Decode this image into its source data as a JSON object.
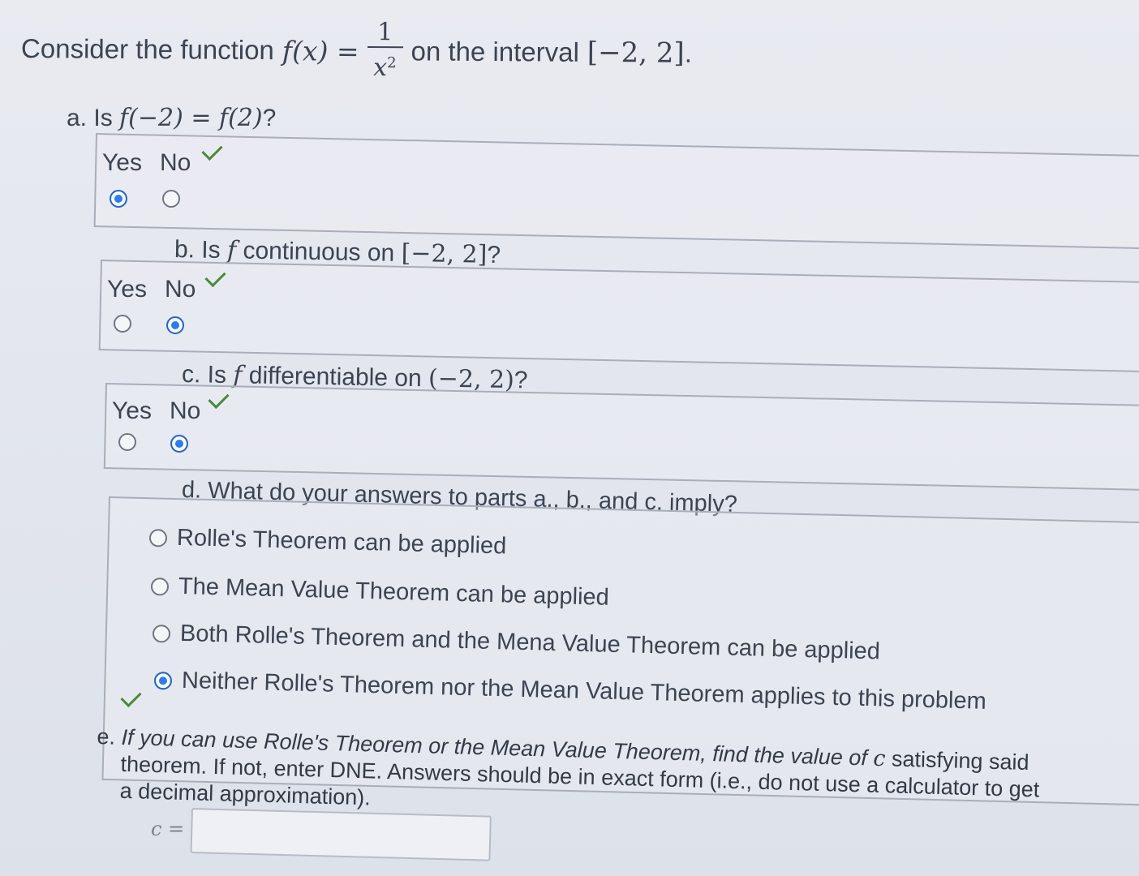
{
  "intro": {
    "prefix": "Consider the function",
    "func": "f(x) =",
    "numerator": "1",
    "denominator": "x",
    "exponent": "2",
    "middle": "on the interval",
    "interval": "[−2, 2]",
    "end": "."
  },
  "part_a": {
    "prefix": "a. Is",
    "expr": "f(−2) = f(2)",
    "suffix": "?",
    "yes_label": "Yes",
    "no_label": "No",
    "selected": "Yes"
  },
  "part_b": {
    "prefix": "b. Is",
    "f": "f",
    "middle": "continuous on",
    "interval": "[−2, 2]",
    "suffix": "?",
    "yes_label": "Yes",
    "no_label": "No",
    "selected": "No"
  },
  "part_c": {
    "prefix": "c. Is",
    "f": "f",
    "middle": "differentiable on",
    "interval": "(−2, 2)",
    "suffix": "?",
    "yes_label": "Yes",
    "no_label": "No",
    "selected": "No"
  },
  "part_d": {
    "question": "d. What do your answers to parts a., b., and c. imply?",
    "options": [
      "Rolle's Theorem can be applied",
      "The Mean Value Theorem can be applied",
      "Both Rolle's Theorem and the Mena Value Theorem can be applied",
      "Neither Rolle's Theorem nor the Mean Value Theorem applies to this problem"
    ],
    "selected_index": 3
  },
  "part_e": {
    "line1_prefix": "e.",
    "line1": "If you can use Rolle's Theorem or the Mean Value Theorem, find the value of",
    "c_var": "c",
    "line1_suffix": "satisfying said",
    "line2": "theorem. If not, enter DNE. Answers should be in exact form (i.e., do not use a calculator to get",
    "line3": "a decimal approximation).",
    "input_label": "c =",
    "input_value": ""
  },
  "colors": {
    "check": "#4a8a3a",
    "radio_selected": "#2e7cf0",
    "border": "#a8aeba",
    "text": "#3c4452"
  }
}
